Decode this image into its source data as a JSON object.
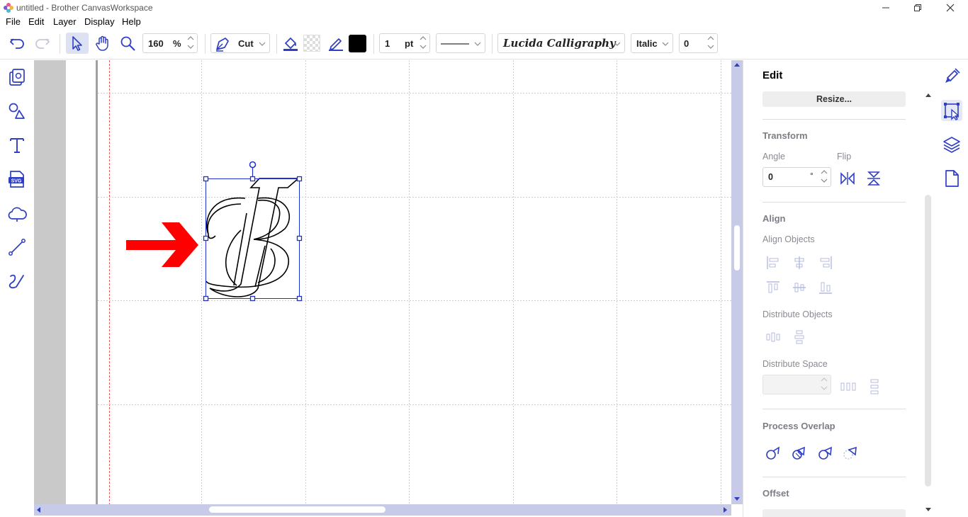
{
  "window": {
    "title": "untitled - Brother CanvasWorkspace"
  },
  "menu": [
    "File",
    "Edit",
    "Layer",
    "Display",
    "Help"
  ],
  "toolbar": {
    "zoom_value": "160",
    "zoom_unit": "%",
    "mode_label": "Cut",
    "line_width": "1",
    "line_width_unit": "pt",
    "font_name": "Lucida Calligraphy",
    "font_style": "Italic",
    "spacing_value": "0",
    "stroke_color": "#000000"
  },
  "panel": {
    "title": "Edit",
    "resize_label": "Resize...",
    "transform_heading": "Transform",
    "angle_label": "Angle",
    "angle_value": "0",
    "angle_unit": "°",
    "flip_label": "Flip",
    "align_heading": "Align",
    "align_objects_label": "Align Objects",
    "distribute_objects_label": "Distribute Objects",
    "distribute_space_label": "Distribute Space",
    "process_overlap_heading": "Process Overlap",
    "offset_heading": "Offset"
  },
  "canvas": {
    "letter_glyph": "B",
    "accent_color": "#1d2fcf",
    "arrow_color": "#ff0000"
  }
}
